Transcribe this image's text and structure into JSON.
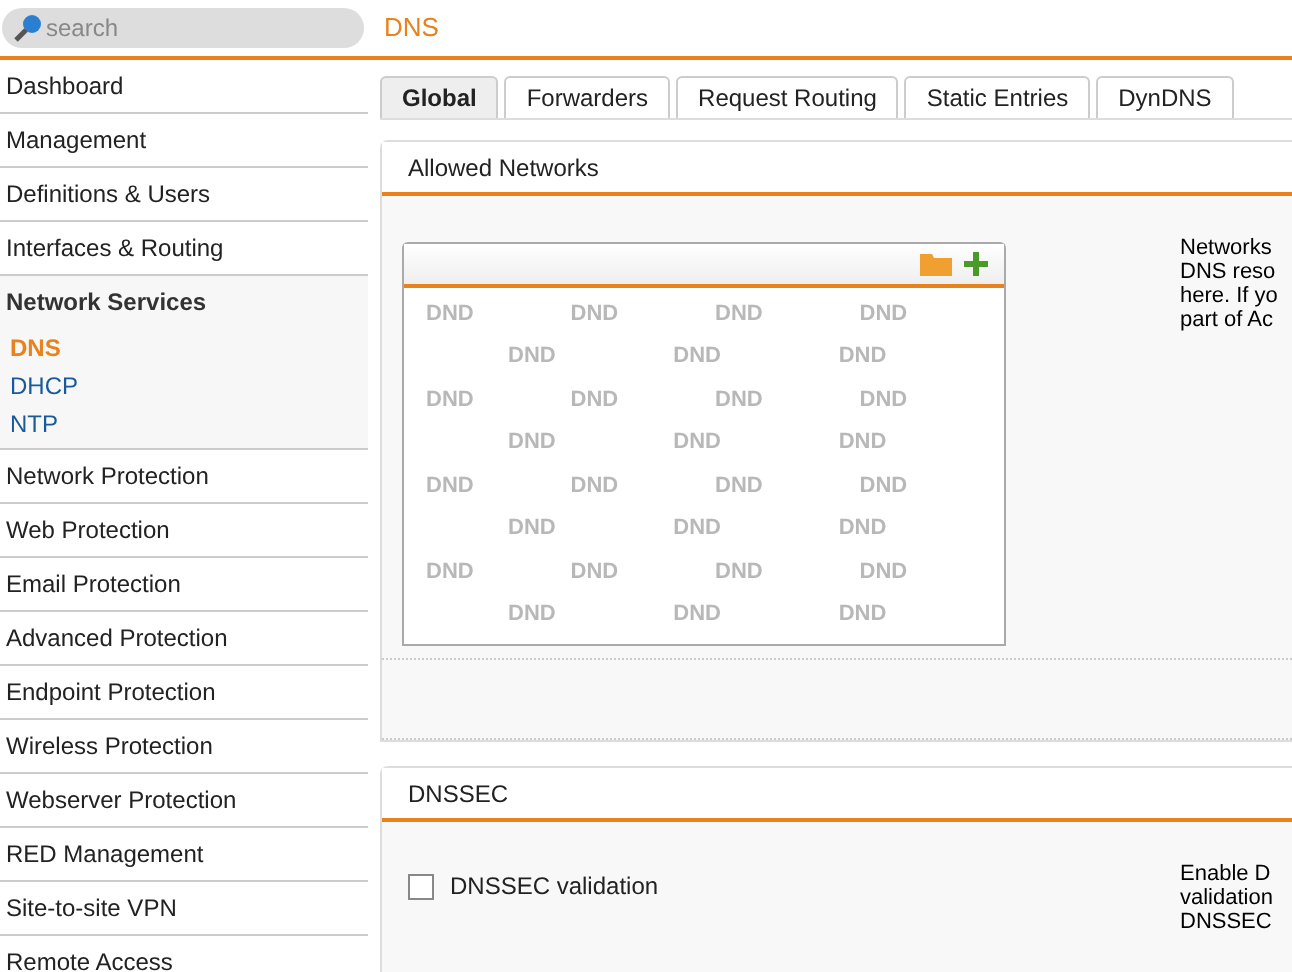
{
  "search": {
    "placeholder": "search"
  },
  "page_title": "DNS",
  "sidebar": {
    "items": [
      {
        "label": "Dashboard",
        "expanded": false
      },
      {
        "label": "Management",
        "expanded": false
      },
      {
        "label": "Definitions & Users",
        "expanded": false
      },
      {
        "label": "Interfaces & Routing",
        "expanded": false
      },
      {
        "label": "Network Services",
        "expanded": true,
        "children": [
          {
            "label": "DNS",
            "selected": true
          },
          {
            "label": "DHCP",
            "selected": false
          },
          {
            "label": "NTP",
            "selected": false
          }
        ]
      },
      {
        "label": "Network Protection",
        "expanded": false
      },
      {
        "label": "Web Protection",
        "expanded": false
      },
      {
        "label": "Email Protection",
        "expanded": false
      },
      {
        "label": "Advanced Protection",
        "expanded": false
      },
      {
        "label": "Endpoint Protection",
        "expanded": false
      },
      {
        "label": "Wireless Protection",
        "expanded": false
      },
      {
        "label": "Webserver Protection",
        "expanded": false
      },
      {
        "label": "RED Management",
        "expanded": false
      },
      {
        "label": "Site-to-site VPN",
        "expanded": false
      },
      {
        "label": "Remote Access",
        "expanded": false
      }
    ]
  },
  "tabs": [
    {
      "label": "Global",
      "selected": true
    },
    {
      "label": "Forwarders",
      "selected": false
    },
    {
      "label": "Request Routing",
      "selected": false
    },
    {
      "label": "Static Entries",
      "selected": false
    },
    {
      "label": "DynDNS",
      "selected": false
    }
  ],
  "sections": [
    {
      "title": "Allowed Networks",
      "kind": "list",
      "drop_hints": [
        "DND",
        "DND",
        "DND",
        "DND",
        "DND",
        "DND",
        "DND",
        "DND",
        "DND",
        "DND",
        "DND",
        "DND",
        "DND",
        "DND",
        "DND",
        "DND",
        "DND",
        "DND",
        "DND",
        "DND",
        "DND",
        "DND",
        "DND",
        "DND",
        "DND",
        "DND",
        "DND",
        "DND"
      ],
      "description_lines": [
        "Networks",
        "DNS reso",
        "here. If yo",
        "part of Ac"
      ]
    },
    {
      "title": "DNSSEC",
      "kind": "checkbox",
      "checkbox": {
        "label": "DNSSEC validation",
        "checked": false
      },
      "description_lines": [
        "Enable D",
        "validation",
        "DNSSEC"
      ]
    }
  ]
}
